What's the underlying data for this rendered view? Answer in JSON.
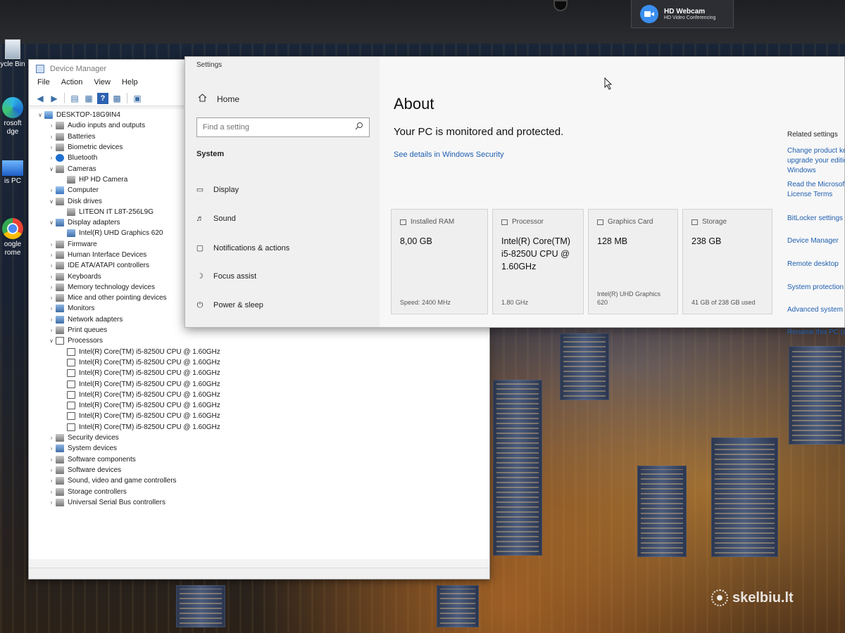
{
  "bezel": {
    "webcam_title": "HD Webcam",
    "webcam_subtitle": "HD Video Conferencing"
  },
  "desktop": {
    "icons": [
      {
        "label": "ycle Bin",
        "icon": "recycle-bin-icon"
      },
      {
        "label": "rosoft dge",
        "icon": "edge-icon"
      },
      {
        "label": "is PC",
        "icon": "this-pc-icon"
      },
      {
        "label": "oogle rome",
        "icon": "chrome-icon"
      }
    ],
    "watermark": "skelbiu.lt"
  },
  "device_manager": {
    "title": "Device Manager",
    "menu": [
      "File",
      "Action",
      "View",
      "Help"
    ],
    "tree": [
      {
        "label": "DESKTOP-18G9IN4",
        "level": 0,
        "expanded": true,
        "icon": "pc"
      },
      {
        "label": "Audio inputs and outputs",
        "level": 1,
        "expanded": false,
        "icon": "gray"
      },
      {
        "label": "Batteries",
        "level": 1,
        "expanded": false,
        "icon": "gray"
      },
      {
        "label": "Biometric devices",
        "level": 1,
        "expanded": false,
        "icon": "gray"
      },
      {
        "label": "Bluetooth",
        "level": 1,
        "expanded": false,
        "icon": "bt"
      },
      {
        "label": "Cameras",
        "level": 1,
        "expanded": true,
        "icon": "gray"
      },
      {
        "label": "HP HD Camera",
        "level": 2,
        "icon": "gray"
      },
      {
        "label": "Computer",
        "level": 1,
        "expanded": false,
        "icon": "pc"
      },
      {
        "label": "Disk drives",
        "level": 1,
        "expanded": true,
        "icon": "gray"
      },
      {
        "label": "LITEON IT L8T-256L9G",
        "level": 2,
        "icon": "gray"
      },
      {
        "label": "Display adapters",
        "level": 1,
        "expanded": true,
        "icon": "dev"
      },
      {
        "label": "Intel(R) UHD Graphics 620",
        "level": 2,
        "icon": "dev"
      },
      {
        "label": "Firmware",
        "level": 1,
        "expanded": false,
        "icon": "gray"
      },
      {
        "label": "Human Interface Devices",
        "level": 1,
        "expanded": false,
        "icon": "gray"
      },
      {
        "label": "IDE ATA/ATAPI controllers",
        "level": 1,
        "expanded": false,
        "icon": "gray"
      },
      {
        "label": "Keyboards",
        "level": 1,
        "expanded": false,
        "icon": "gray"
      },
      {
        "label": "Memory technology devices",
        "level": 1,
        "expanded": false,
        "icon": "gray"
      },
      {
        "label": "Mice and other pointing devices",
        "level": 1,
        "expanded": false,
        "icon": "gray"
      },
      {
        "label": "Monitors",
        "level": 1,
        "expanded": false,
        "icon": "dev"
      },
      {
        "label": "Network adapters",
        "level": 1,
        "expanded": false,
        "icon": "dev"
      },
      {
        "label": "Print queues",
        "level": 1,
        "expanded": false,
        "icon": "gray"
      },
      {
        "label": "Processors",
        "level": 1,
        "expanded": true,
        "icon": "cpu"
      },
      {
        "label": "Intel(R) Core(TM) i5-8250U CPU @ 1.60GHz",
        "level": 2,
        "icon": "cpu"
      },
      {
        "label": "Intel(R) Core(TM) i5-8250U CPU @ 1.60GHz",
        "level": 2,
        "icon": "cpu"
      },
      {
        "label": "Intel(R) Core(TM) i5-8250U CPU @ 1.60GHz",
        "level": 2,
        "icon": "cpu"
      },
      {
        "label": "Intel(R) Core(TM) i5-8250U CPU @ 1.60GHz",
        "level": 2,
        "icon": "cpu"
      },
      {
        "label": "Intel(R) Core(TM) i5-8250U CPU @ 1.60GHz",
        "level": 2,
        "icon": "cpu"
      },
      {
        "label": "Intel(R) Core(TM) i5-8250U CPU @ 1.60GHz",
        "level": 2,
        "icon": "cpu"
      },
      {
        "label": "Intel(R) Core(TM) i5-8250U CPU @ 1.60GHz",
        "level": 2,
        "icon": "cpu"
      },
      {
        "label": "Intel(R) Core(TM) i5-8250U CPU @ 1.60GHz",
        "level": 2,
        "icon": "cpu"
      },
      {
        "label": "Security devices",
        "level": 1,
        "expanded": false,
        "icon": "gray"
      },
      {
        "label": "System devices",
        "level": 1,
        "expanded": false,
        "icon": "dev"
      },
      {
        "label": "Software components",
        "level": 1,
        "expanded": false,
        "icon": "gray"
      },
      {
        "label": "Software devices",
        "level": 1,
        "expanded": false,
        "icon": "gray"
      },
      {
        "label": "Sound, video and game controllers",
        "level": 1,
        "expanded": false,
        "icon": "gray"
      },
      {
        "label": "Storage controllers",
        "level": 1,
        "expanded": false,
        "icon": "gray"
      },
      {
        "label": "Universal Serial Bus controllers",
        "level": 1,
        "expanded": false,
        "icon": "gray"
      }
    ]
  },
  "settings": {
    "window_title": "Settings",
    "nav": {
      "home": "Home",
      "search_placeholder": "Find a setting",
      "section": "System",
      "items": [
        {
          "label": "Display",
          "icon": "display-icon"
        },
        {
          "label": "Sound",
          "icon": "sound-icon"
        },
        {
          "label": "Notifications & actions",
          "icon": "notifications-icon"
        },
        {
          "label": "Focus assist",
          "icon": "focus-assist-icon"
        },
        {
          "label": "Power & sleep",
          "icon": "power-icon"
        }
      ]
    },
    "about": {
      "title": "About",
      "status": "Your PC is monitored and protected.",
      "security_link": "See details in Windows Security",
      "cards": [
        {
          "label": "Installed RAM",
          "value": "8,00 GB",
          "footer": "Speed: 2400 MHz"
        },
        {
          "label": "Processor",
          "value": "Intel(R) Core(TM) i5-8250U CPU @ 1.60GHz",
          "footer": "1.80 GHz"
        },
        {
          "label": "Graphics Card",
          "value": "128 MB",
          "footer": "Intel(R) UHD Graphics 620"
        },
        {
          "label": "Storage",
          "value": "238 GB",
          "footer": "41 GB of 238 GB used"
        }
      ]
    },
    "related": {
      "heading": "Related settings",
      "links": [
        "Change product key or upgrade your edition of Windows",
        "Read the Microsoft Software License Terms",
        "BitLocker settings",
        "Device Manager",
        "Remote desktop",
        "System protection",
        "Advanced system settings",
        "Rename this PC (advanced)"
      ]
    }
  }
}
